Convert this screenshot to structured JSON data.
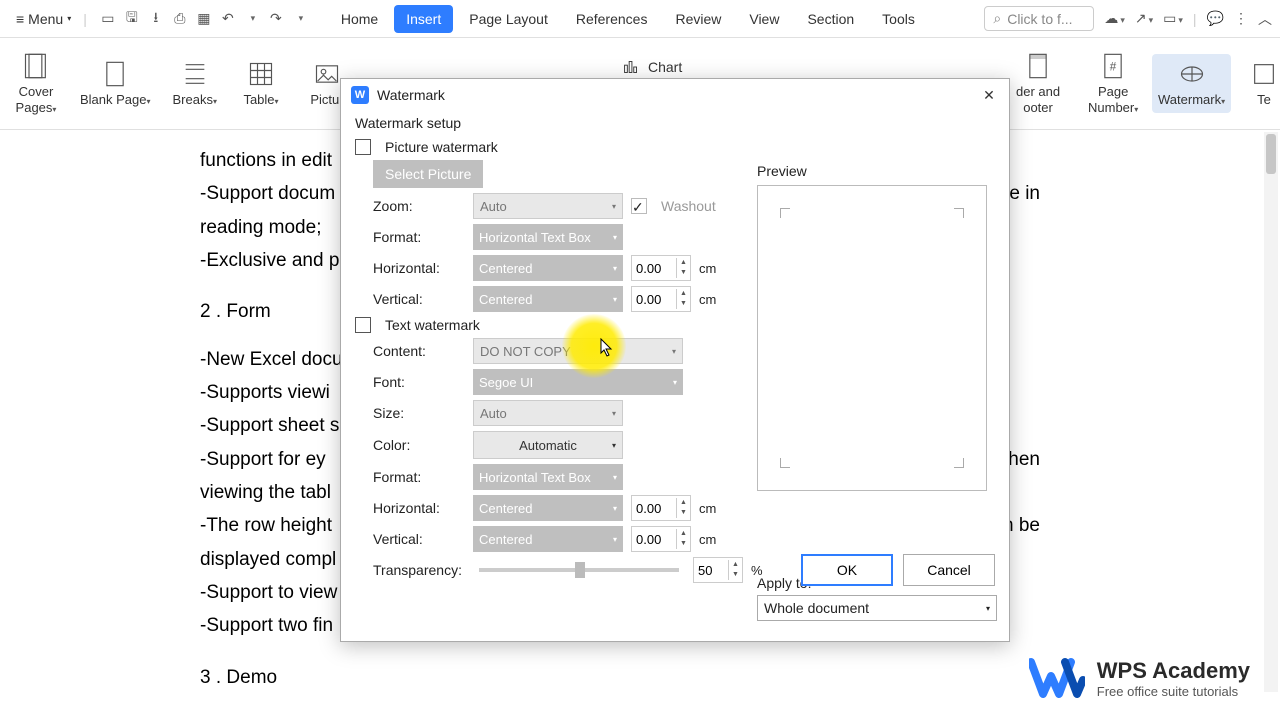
{
  "menubar": {
    "menu_label": "Menu",
    "search_placeholder": "Click to f...",
    "tabs": [
      "Home",
      "Insert",
      "Page Layout",
      "References",
      "Review",
      "View",
      "Section",
      "Tools"
    ]
  },
  "ribbon": {
    "cover_pages": "Cover\nPages",
    "blank_page": "Blank Page",
    "breaks": "Breaks",
    "table": "Table",
    "picture": "Pictur",
    "chart": "Chart",
    "header_footer": "der and\nooter",
    "page_number": "Page\nNumber",
    "watermark": "Watermark",
    "text_right": "Te"
  },
  "dialog": {
    "title": "Watermark",
    "setup_label": "Watermark setup",
    "picture_watermark": "Picture watermark",
    "select_picture": "Select Picture",
    "zoom_label": "Zoom:",
    "zoom_value": "Auto",
    "washout": "Washout",
    "format_label": "Format:",
    "format_value": "Horizontal Text Box",
    "horizontal_label": "Horizontal:",
    "horizontal_value": "Centered",
    "horizontal_offset": "0.00",
    "vertical_label": "Vertical:",
    "vertical_value": "Centered",
    "vertical_offset": "0.00",
    "cm": "cm",
    "text_watermark": "Text watermark",
    "content_label": "Content:",
    "content_value": "DO NOT COPY",
    "font_label": "Font:",
    "font_value": "Segoe UI",
    "size_label": "Size:",
    "size_value": "Auto",
    "color_label": "Color:",
    "color_value": "Automatic",
    "t_format_label": "Format:",
    "t_format_value": "Horizontal Text Box",
    "t_horizontal_label": "Horizontal:",
    "t_horizontal_value": "Centered",
    "t_horizontal_offset": "0.00",
    "t_vertical_label": "Vertical:",
    "t_vertical_value": "Centered",
    "t_vertical_offset": "0.00",
    "transparency_label": "Transparency:",
    "transparency_value": "50",
    "percent": "%",
    "preview_label": "Preview",
    "apply_label": "Apply to:",
    "apply_value": "Whole document",
    "ok": "OK",
    "cancel": "Cancel"
  },
  "doc": {
    "l1": "functions in edit",
    "l2": "-Support docum",
    "l3": "reading mode;",
    "l4": "-Exclusive and p",
    "sec2": "2 .  Form",
    "l5": "-New Excel docu",
    "l6": "-Supports viewi",
    "l7": "-Support sheet s",
    "l8": "-Support  for  ey",
    "l8b": "when",
    "l9": "viewing the tabl",
    "l10": "-The row height",
    "l10b": "n be",
    "l11": "displayed compl",
    "l12": "-Support to view",
    "l13": "-Support two fin",
    "sec3": "3 . Demo",
    "right1": "ze in"
  },
  "logo": {
    "t1": "WPS Academy",
    "t2": "Free office suite tutorials"
  }
}
